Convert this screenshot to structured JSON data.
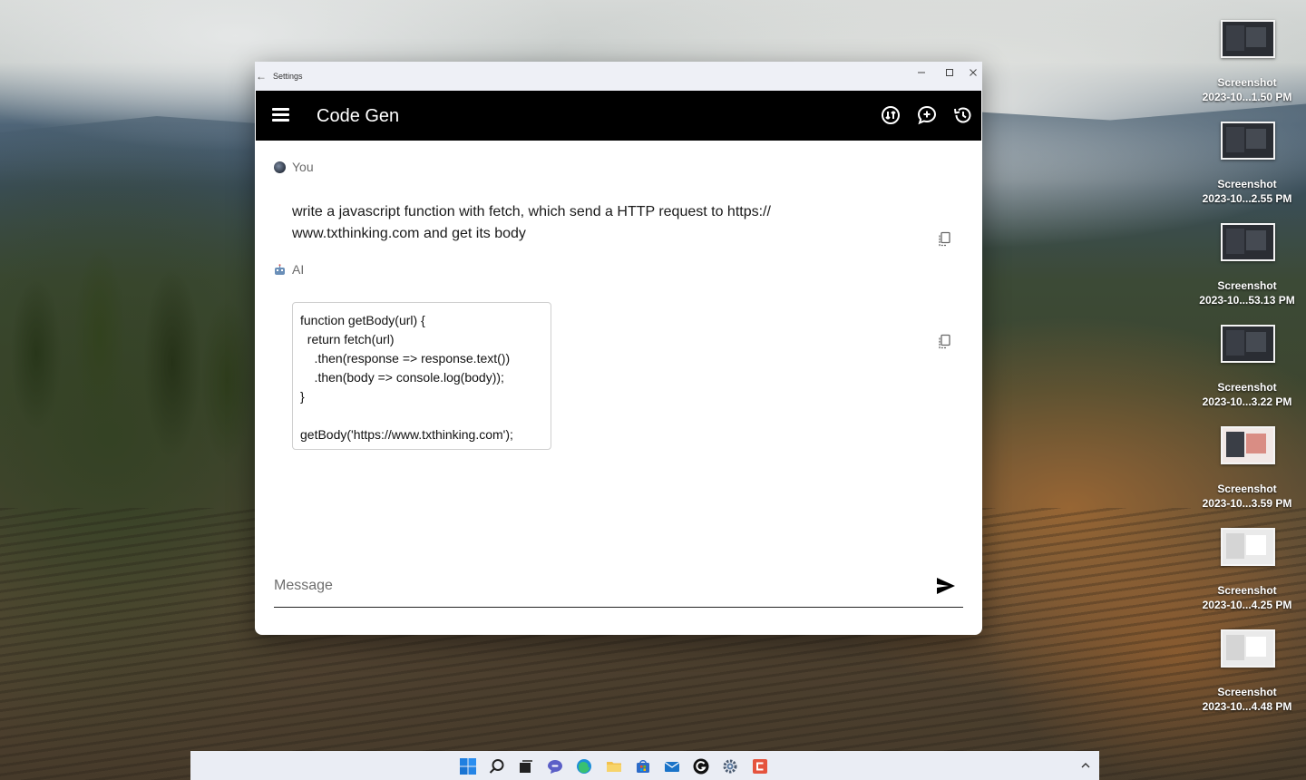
{
  "window": {
    "title": "Settings",
    "back_glyph": "←"
  },
  "appbar": {
    "title": "Code Gen",
    "icons": [
      "menu-icon",
      "swap-model-icon",
      "new-chat-icon",
      "history-icon"
    ]
  },
  "chat": {
    "messages": [
      {
        "sender": "You",
        "text": "write a javascript function with fetch, which send a HTTP request to https:// www.txthinking.com and get its body"
      },
      {
        "sender": "AI",
        "code_lines": [
          "function getBody(url) {",
          "  return fetch(url)",
          "    .then(response => response.text())",
          "    .then(body => console.log(body));",
          "}",
          "",
          "getBody('https://www.txthinking.com');"
        ]
      }
    ]
  },
  "composer": {
    "placeholder": "Message",
    "value": ""
  },
  "desktop": {
    "icons": [
      {
        "name": "Screenshot",
        "subtitle": "2023-10...1.50 PM",
        "style": "dark"
      },
      {
        "name": "Screenshot",
        "subtitle": "2023-10...2.55 PM",
        "style": "dark"
      },
      {
        "name": "Screenshot",
        "subtitle": "2023-10...53.13 PM",
        "style": "dark"
      },
      {
        "name": "Screenshot",
        "subtitle": "2023-10...3.22 PM",
        "style": "dark"
      },
      {
        "name": "Screenshot",
        "subtitle": "2023-10...3.59 PM",
        "style": "pink"
      },
      {
        "name": "Screenshot",
        "subtitle": "2023-10...4.25 PM",
        "style": "light"
      },
      {
        "name": "Screenshot",
        "subtitle": "2023-10...4.48 PM",
        "style": "light"
      }
    ]
  },
  "taskbar": {
    "icons": [
      "windows-start-icon",
      "search-icon",
      "task-view-icon",
      "chat-icon",
      "edge-icon",
      "file-explorer-icon",
      "store-icon",
      "mail-icon",
      "app-g-icon",
      "settings-icon",
      "app-c-icon",
      "chevron-up-icon"
    ]
  }
}
